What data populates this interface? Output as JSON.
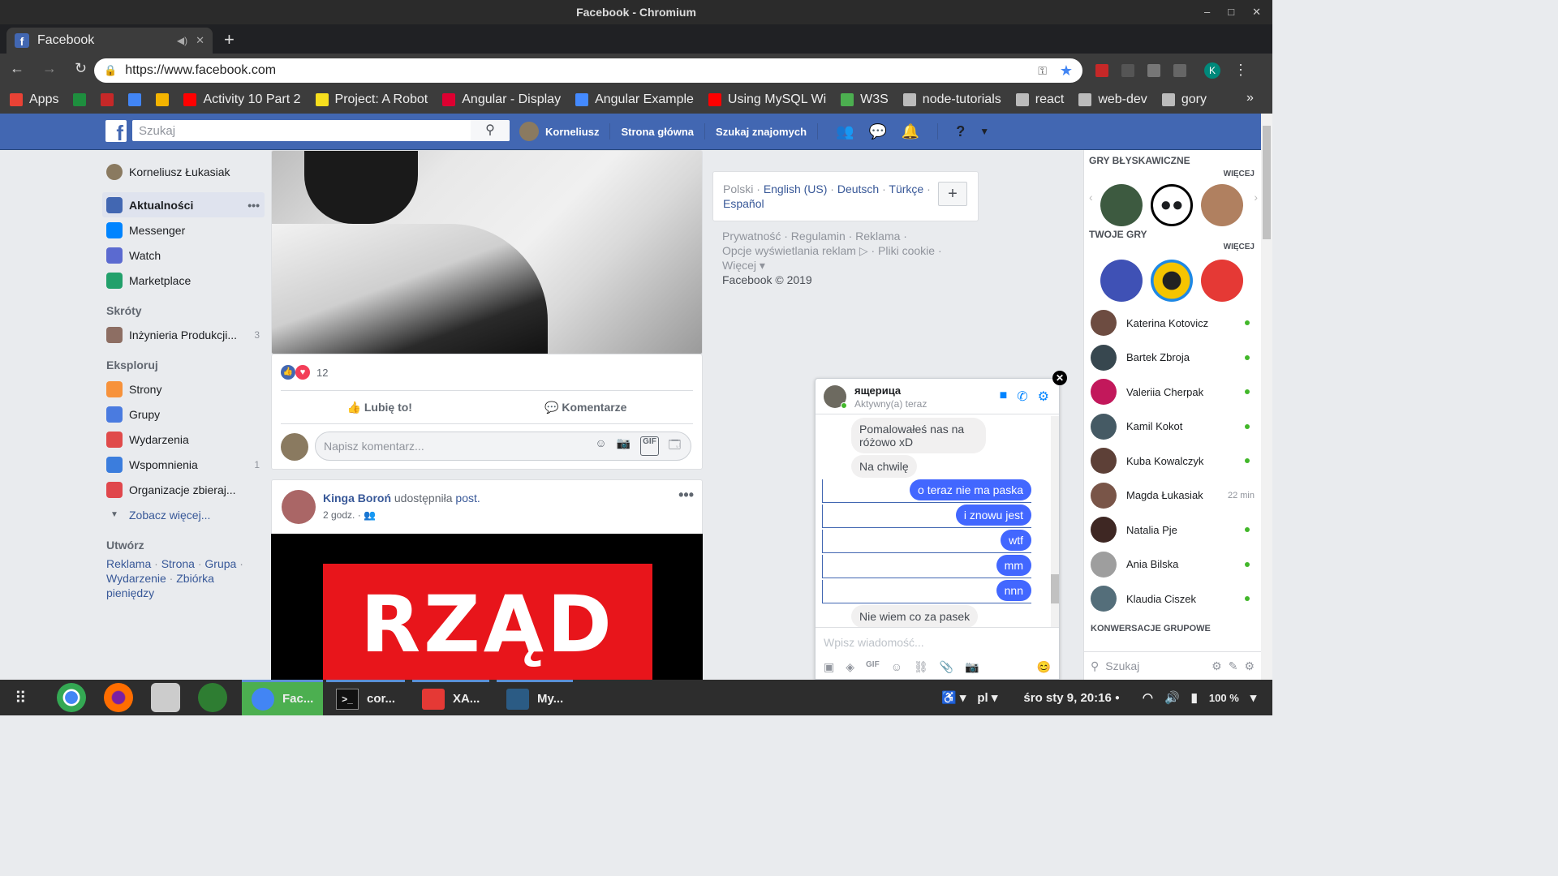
{
  "window": {
    "title": "Facebook - Chromium"
  },
  "tab": {
    "title": "Facebook"
  },
  "address": {
    "url": "https://www.facebook.com"
  },
  "bookmarks": [
    {
      "label": "Apps",
      "color": "#e94235"
    },
    {
      "label": "",
      "color": "#1e8e3e"
    },
    {
      "label": "",
      "color": "#c62828"
    },
    {
      "label": "",
      "color": "#4285f4"
    },
    {
      "label": "",
      "color": "#f4b400"
    },
    {
      "label": "Activity 10 Part 2",
      "color": "#ff0000"
    },
    {
      "label": "Project: A Robot",
      "color": "#f7df1e"
    },
    {
      "label": "Angular - Display",
      "color": "#dd0031"
    },
    {
      "label": "Angular Example",
      "color": "#448aff"
    },
    {
      "label": "Using MySQL Wi",
      "color": "#ff0000"
    },
    {
      "label": "W3S",
      "color": "#4caf50"
    },
    {
      "label": "node-tutorials",
      "color": "#bbbbbb"
    },
    {
      "label": "react",
      "color": "#bbbbbb"
    },
    {
      "label": "web-dev",
      "color": "#bbbbbb"
    },
    {
      "label": "gory",
      "color": "#bbbbbb"
    }
  ],
  "fb_header": {
    "search_placeholder": "Szukaj",
    "profile_name": "Korneliusz",
    "home": "Strona główna",
    "find_friends": "Szukaj znajomych"
  },
  "left_sidebar": {
    "user": "Korneliusz Łukasiak",
    "main": [
      {
        "label": "Aktualności",
        "color": "#4267b2"
      },
      {
        "label": "Messenger",
        "color": "#0084ff"
      },
      {
        "label": "Watch",
        "color": "#5b6ad0"
      },
      {
        "label": "Marketplace",
        "color": "#22a06b"
      }
    ],
    "shortcuts_title": "Skróty",
    "shortcuts": [
      {
        "label": "Inżynieria Produkcji...",
        "count": "3"
      }
    ],
    "explore_title": "Eksploruj",
    "explore": [
      {
        "label": "Strony",
        "count": "",
        "color": "#f7923b"
      },
      {
        "label": "Grupy",
        "count": "",
        "color": "#4a7be0"
      },
      {
        "label": "Wydarzenia",
        "count": "",
        "color": "#e04a4a"
      },
      {
        "label": "Wspomnienia",
        "count": "1",
        "color": "#3b7ddd"
      },
      {
        "label": "Organizacje zbieraj...",
        "count": "",
        "color": "#e0474c"
      }
    ],
    "see_more": "Zobacz więcej...",
    "create_title": "Utwórz",
    "create_links": [
      "Reklama",
      "Strona",
      "Grupa",
      "Wydarzenie",
      "Zbiórka pieniędzy"
    ]
  },
  "post1": {
    "reaction_count": "12",
    "like": "Lubię to!",
    "comment": "Komentarze",
    "comment_placeholder": "Napisz komentarz..."
  },
  "post2": {
    "author": "Kinga Boroń",
    "action": "udostępniła",
    "object": "post.",
    "time": "2 godz.",
    "image_text": "RZĄD"
  },
  "languages": {
    "current": "Polski",
    "options": [
      "English (US)",
      "Deutsch",
      "Türkçe",
      "Español"
    ]
  },
  "footer": {
    "line1": "Prywatność · Regulamin · Reklama ·",
    "line2": "Opcje wyświetlania reklam ▷ · Pliki cookie ·",
    "line3": "Więcej ▾",
    "copyright": "Facebook © 2019"
  },
  "chat_sidebar": {
    "instant_games": "GRY BŁYSKAWICZNE",
    "more1": "WIĘCEJ",
    "your_games": "TWOJE GRY",
    "more2": "WIĘCEJ",
    "contacts": [
      {
        "name": "Katerina Kotovicz",
        "status": "online"
      },
      {
        "name": "Bartek Zbroja",
        "status": "online"
      },
      {
        "name": "Valeriia Cherpak",
        "status": "online"
      },
      {
        "name": "Kamil Kokot",
        "status": "online"
      },
      {
        "name": "Kuba Kowalczyk",
        "status": "online"
      },
      {
        "name": "Magda Łukasiak",
        "status": "22 min"
      },
      {
        "name": "Natalia Pje",
        "status": "online"
      },
      {
        "name": "Ania Bilska",
        "status": "online"
      },
      {
        "name": "Klaudia Ciszek",
        "status": "online"
      }
    ],
    "group_conversations": "KONWERSACJE GRUPOWE",
    "search_placeholder": "Szukaj"
  },
  "chat": {
    "name": "ящерица",
    "status": "Aktywny(a) teraz",
    "messages": [
      {
        "from": "them",
        "text": "Pomalowałeś nas na różowo xD"
      },
      {
        "from": "them",
        "text": "Na chwilę"
      },
      {
        "from": "me",
        "text": "o teraz nie ma paska"
      },
      {
        "from": "me",
        "text": "i znowu jest"
      },
      {
        "from": "me",
        "text": "wtf"
      },
      {
        "from": "me",
        "text": "mm"
      },
      {
        "from": "me",
        "text": "nnn"
      },
      {
        "from": "them",
        "text": "Nie wiem co za pasek"
      }
    ],
    "input_placeholder": "Wpisz wiadomość...",
    "accent": "#4267ff"
  },
  "taskbar": {
    "windows": [
      {
        "label": "Fac..."
      },
      {
        "label": "cor..."
      },
      {
        "label": "XA..."
      },
      {
        "label": "My..."
      }
    ],
    "lang": "pl",
    "clock": "śro sty  9, 20:16",
    "battery": "100 %"
  }
}
